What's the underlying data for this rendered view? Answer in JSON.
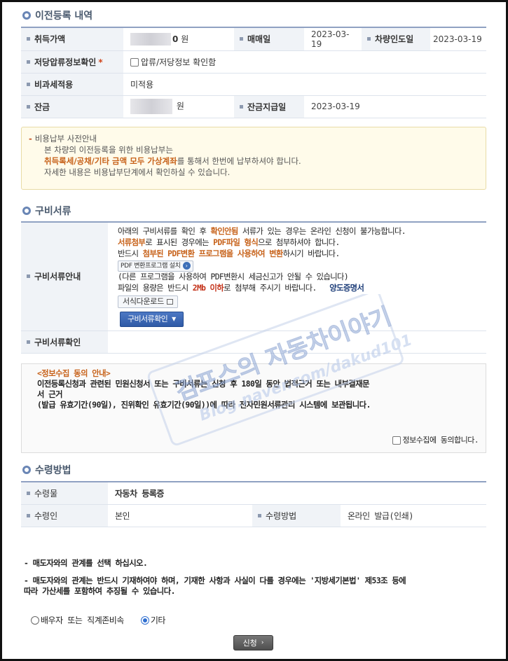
{
  "transfer": {
    "title": "이전등록 내역",
    "rows": {
      "acq_label": "취득가액",
      "acq_tail": "0",
      "acq_unit": "원",
      "sale_label": "매매일",
      "sale_date": "2023-03-19",
      "delivery_label": "차량인도일",
      "delivery_date": "2023-03-19",
      "seizure_label": "저당압류정보확인",
      "seizure_req": "*",
      "seizure_check": "압류/저당정보 확인함",
      "tax_label": "비과세적용",
      "tax_value": "미적용",
      "balance_label": "잔금",
      "balance_unit": "원",
      "balance_date_label": "잔금지급일",
      "balance_date": "2023-03-19"
    },
    "notice": {
      "title": "비용납부 사전안내",
      "line1": "본 차량의 이전등록을 위한 비용납부는",
      "line2_strong": "취득록세/공채/기타 금액 모두 가상계좌",
      "line2_rest": "를 통해서 한번에 납부하셔야 합니다.",
      "line3": "자세한 내용은 비용납부단계에서 확인하실 수 있습니다."
    }
  },
  "docs": {
    "title": "구비서류",
    "guide_label": "구비서류안내",
    "l1a": "아래의 구비서류를 확인 후 ",
    "l1b": "확인안됨",
    "l1c": " 서류가 있는 경우는 온라인 신청이 불가능합니다.",
    "l2a": "서류첨부",
    "l2b": "로 표시된 경우에는 ",
    "l2c": "PDF파일 형식",
    "l2d": "으로 첨부하셔야 합니다.",
    "l3a": "반드시 ",
    "l3b": "첨부된 PDF변환 프로그램을 사용하여 변환",
    "l3c": "하시기 바랍니다.",
    "pdf_btn": "PDF 변환프로그램 설치",
    "l4": "(다른 프로그램을 사용하여 PDF변환시 세금신고가 안될 수 있습니다)",
    "l5a": "파일의 용량은 반드시 ",
    "l5b": "2Mb 이하",
    "l5c": "로 첨부해 주시기 바랍니다.",
    "l5d": "양도증명서",
    "form_btn": "서식다운로드",
    "check_btn": "구비서류확인",
    "confirm_label": "구비서류확인"
  },
  "privacy": {
    "title": "<정보수집 동의 안내>",
    "line1": "이전등록신청과 관련된 민원신청서 또는 구비서류는 신청 후 180일 동안 법적근거 또는 내부결재문",
    "line2": "서 근거",
    "line3": "(발급 유효기간(90일), 진위확인 유효기간(90일))에 따라 전자민원서류관리 시스템에 보관됩니다.",
    "agree": "정보수집에 동의합니다."
  },
  "receive": {
    "title": "수령방법",
    "item_label": "수령물",
    "item_value": "자동차 등록증",
    "person_label": "수령인",
    "person_value": "본인",
    "method_label": "수령방법",
    "method_value": "온라인 발급(인쇄)"
  },
  "notes": {
    "n1": "- 매도자와의 관계를 선택 하십시오.",
    "n2": "- 매도자와의 관계는 반드시 기재하여야 하며, 기재한 사항과 사실이 다를 경우에는 '지방세기본법' 제53조 등에",
    "n3": "따라 가산세를 포함하여 추징될 수 있습니다."
  },
  "relation": {
    "opt1": "배우자 또는 직계존비속",
    "opt2": "기타",
    "selected": "기타"
  },
  "submit_label": "신청",
  "watermark": {
    "line1": "검포스의 자동차이야기",
    "line2": "Blog.naver.com/dakud101"
  }
}
